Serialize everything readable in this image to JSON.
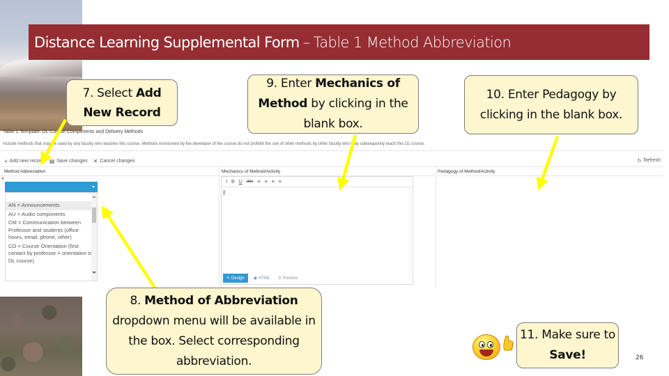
{
  "slide": {
    "title_main": "Distance Learning Supplemental Form",
    "title_separator": "–",
    "title_sub": "Table 1 Method Abbreviation",
    "page_number": "26",
    "colors": {
      "title_bar": "#952d32",
      "callout_fill": "#fdf6cf",
      "callout_border": "#7d7d7d",
      "arrow": "#ffff00",
      "accent_blue": "#2e9ad6"
    }
  },
  "form": {
    "caption": "Table 1 Template: DL Course Components and Delivery Methods",
    "description": "Include methods that may be used by any faculty who teaches this course. Methods envisioned by the developer of the course do not prohibit the use of other methods by other faculty who may subsequently teach this DL course.",
    "toolbar": {
      "add_icon": "plus-icon",
      "add_label": "Add new record",
      "save_icon": "save-icon",
      "save_label": "Save changes",
      "cancel_icon": "x-icon",
      "cancel_label": "Cancel changes",
      "refresh_icon": "refresh-icon",
      "refresh_label": "Refresh"
    },
    "columns": [
      "Method Abbreviation",
      "Mechanics of Method/Activity",
      "Pedagogy of Method/Activity"
    ],
    "dropdown": {
      "selected_value": "",
      "options": [
        "AN = Announcements",
        "AU = Audio components",
        "CM = Communication between Professor and students (office hours, email, phone, other)",
        "CO = Course Orientation (first contact by professor + orientation to DL course)"
      ],
      "highlighted_index": 0
    },
    "editor": {
      "toolbar_tools": [
        "italic",
        "bold",
        "underline",
        "strikethrough",
        "align-left",
        "align-center",
        "align-right",
        "justify"
      ],
      "toolbar_glyphs": [
        "I",
        "B",
        "U",
        "abc",
        "≡",
        "≡",
        "≡",
        "≡"
      ],
      "content": "",
      "modes": [
        {
          "label": "Design",
          "icon": "pencil-icon",
          "active": true
        },
        {
          "label": "HTML",
          "icon": "eye-icon",
          "active": false
        },
        {
          "label": "Preview",
          "icon": "magnifier-icon",
          "active": false
        }
      ]
    }
  },
  "callouts": {
    "c7": {
      "prefix": "7. Select ",
      "bold": "Add New Record",
      "suffix": ""
    },
    "c8": {
      "prefix": "8. ",
      "bold": "Method of Abbreviation",
      "suffix": " dropdown menu will be available in the box.  Select corresponding abbreviation."
    },
    "c9": {
      "prefix": "9. Enter ",
      "bold": "Mechanics of Method",
      "suffix": " by clicking in the blank box."
    },
    "c10": {
      "prefix": "10. Enter Pedagogy by clicking in the blank box.",
      "bold": "",
      "suffix": ""
    },
    "c11": {
      "prefix": "11. Make sure to ",
      "bold": "Save!",
      "suffix": ""
    }
  }
}
